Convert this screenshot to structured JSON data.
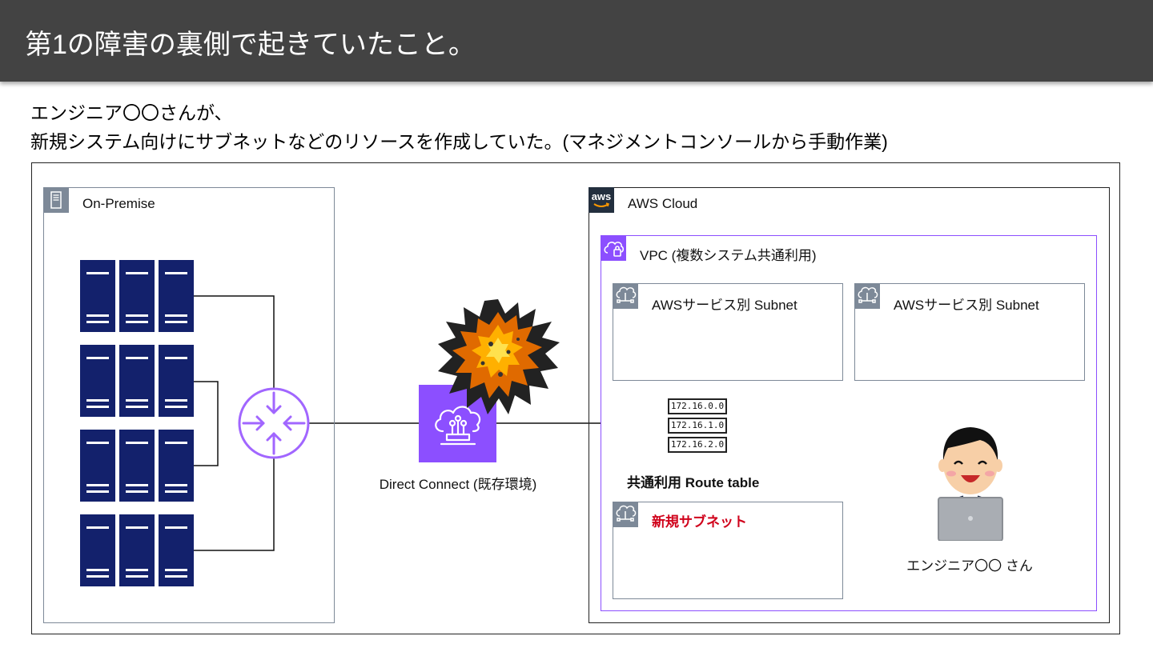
{
  "slide": {
    "title": "第1の障害の裏側で起きていたこと。",
    "intro_line1": "エンジニア〇〇さんが、",
    "intro_line2": "新規システム向けにサブネットなどのリソースを作成していた。(マネジメントコンソールから手動作業)"
  },
  "diagram": {
    "onprem_label": "On-Premise",
    "aws_logo_text": "aws",
    "aws_cloud_label": "AWS Cloud",
    "vpc_label": "VPC (複数システム共通利用)",
    "subnet1_label": "AWSサービス別 Subnet",
    "subnet2_label": "AWSサービス別 Subnet",
    "new_subnet_label": "新規サブネット",
    "dx_label": "Direct Connect (既存環境)",
    "routes": [
      "172.16.0.0",
      "172.16.1.0",
      "172.16.2.0"
    ],
    "route_table_label": "共通利用 Route table",
    "engineer_label": "エンジニア〇〇 さん"
  },
  "colors": {
    "title_bar": "#434343",
    "server_blue": "#13216c",
    "router_purple": "#a166ff",
    "dx_purple": "#8c4fff",
    "vpc_border": "#8c4fff",
    "group_icon_gray": "#7d8998",
    "new_subnet_red": "#d0021b"
  }
}
